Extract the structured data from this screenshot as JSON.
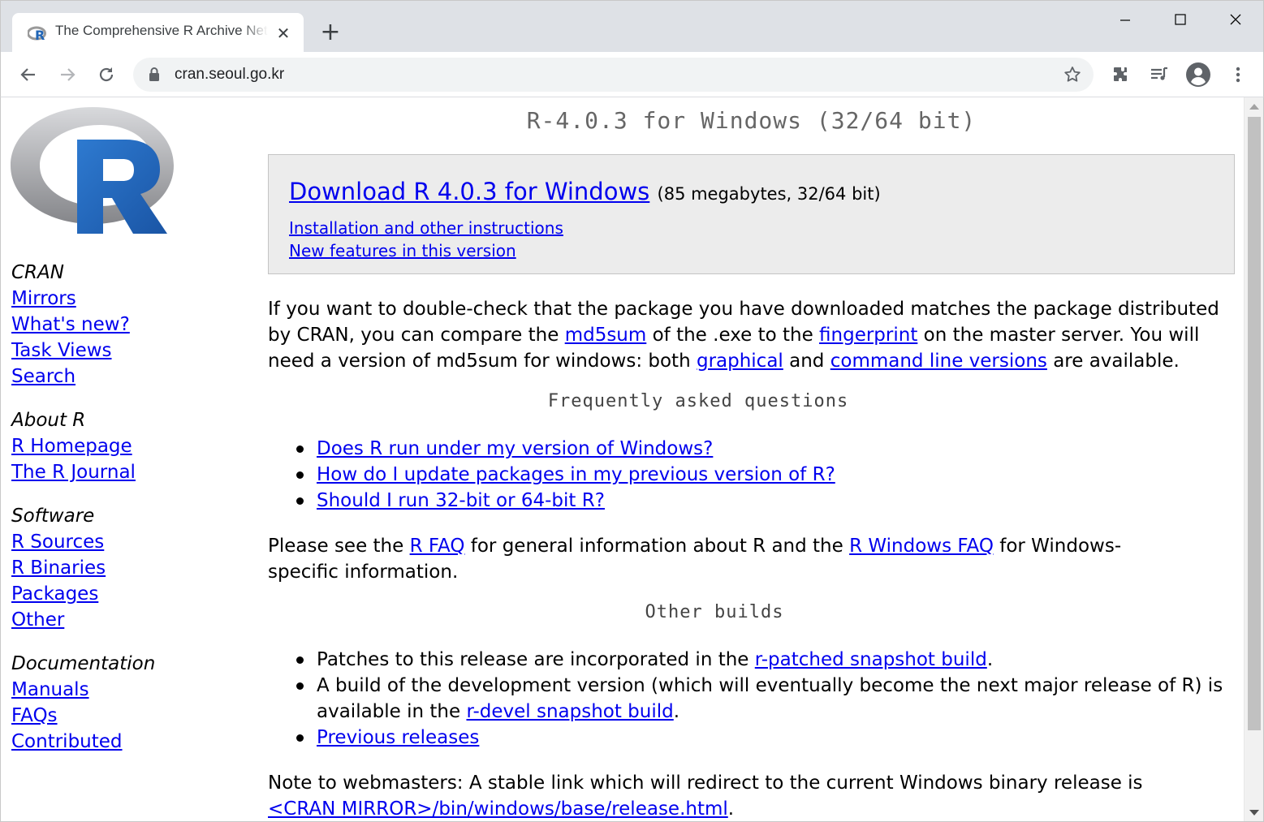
{
  "browser": {
    "tab_title": "The Comprehensive R Archive Network",
    "url": "cran.seoul.go.kr",
    "icons": [
      "back-icon",
      "forward-icon",
      "reload-icon",
      "lock-icon",
      "star-icon",
      "extensions-icon",
      "media-queue-icon",
      "profile-icon",
      "menu-icon"
    ]
  },
  "sidebar": {
    "sections": [
      {
        "heading": "CRAN",
        "links": [
          "Mirrors",
          "What's new?",
          "Task Views",
          "Search"
        ]
      },
      {
        "heading": "About R",
        "links": [
          "R Homepage",
          "The R Journal"
        ]
      },
      {
        "heading": "Software",
        "links": [
          "R Sources",
          "R Binaries",
          "Packages",
          "Other"
        ]
      },
      {
        "heading": "Documentation",
        "links": [
          "Manuals",
          "FAQs",
          "Contributed"
        ]
      }
    ]
  },
  "main": {
    "title": "R-4.0.3 for Windows (32/64 bit)",
    "download": {
      "link": "Download R 4.0.3 for Windows",
      "size": "(85 megabytes, 32/64 bit)",
      "install_link": "Installation and other instructions",
      "features_link": "New features in this version"
    },
    "md5": {
      "t1": "If you want to double-check that the package you have downloaded matches the package distributed by CRAN, you can compare the ",
      "l1": "md5sum",
      "t2": " of the .exe to the ",
      "l2": "fingerprint",
      "t3": " on the master server. You will need a version of md5sum for windows: both ",
      "l3": "graphical",
      "t4": " and ",
      "l4": "command line versions",
      "t5": " are available."
    },
    "faq_heading": "Frequently asked questions",
    "faq_items": [
      "Does R run under my version of Windows?",
      "How do I update packages in my previous version of R?",
      "Should I run 32-bit or 64-bit R?"
    ],
    "see": {
      "t1": "Please see the ",
      "l1": "R FAQ",
      "t2": " for general information about R and the ",
      "l2": "R Windows FAQ",
      "t3": " for Windows-specific information."
    },
    "other_heading": "Other builds",
    "other": {
      "b1_text": "Patches to this release are incorporated in the ",
      "b1_link": "r-patched snapshot build",
      "b1_end": ".",
      "b2_text": "A build of the development version (which will eventually become the next major release of R) is available in the ",
      "b2_link": "r-devel snapshot build",
      "b2_end": ".",
      "b3_link": "Previous releases"
    },
    "note": {
      "text": "Note to webmasters: A stable link which will redirect to the current Windows binary release is",
      "link": "<CRAN MIRROR>/bin/windows/base/release.html",
      "end": "."
    }
  }
}
